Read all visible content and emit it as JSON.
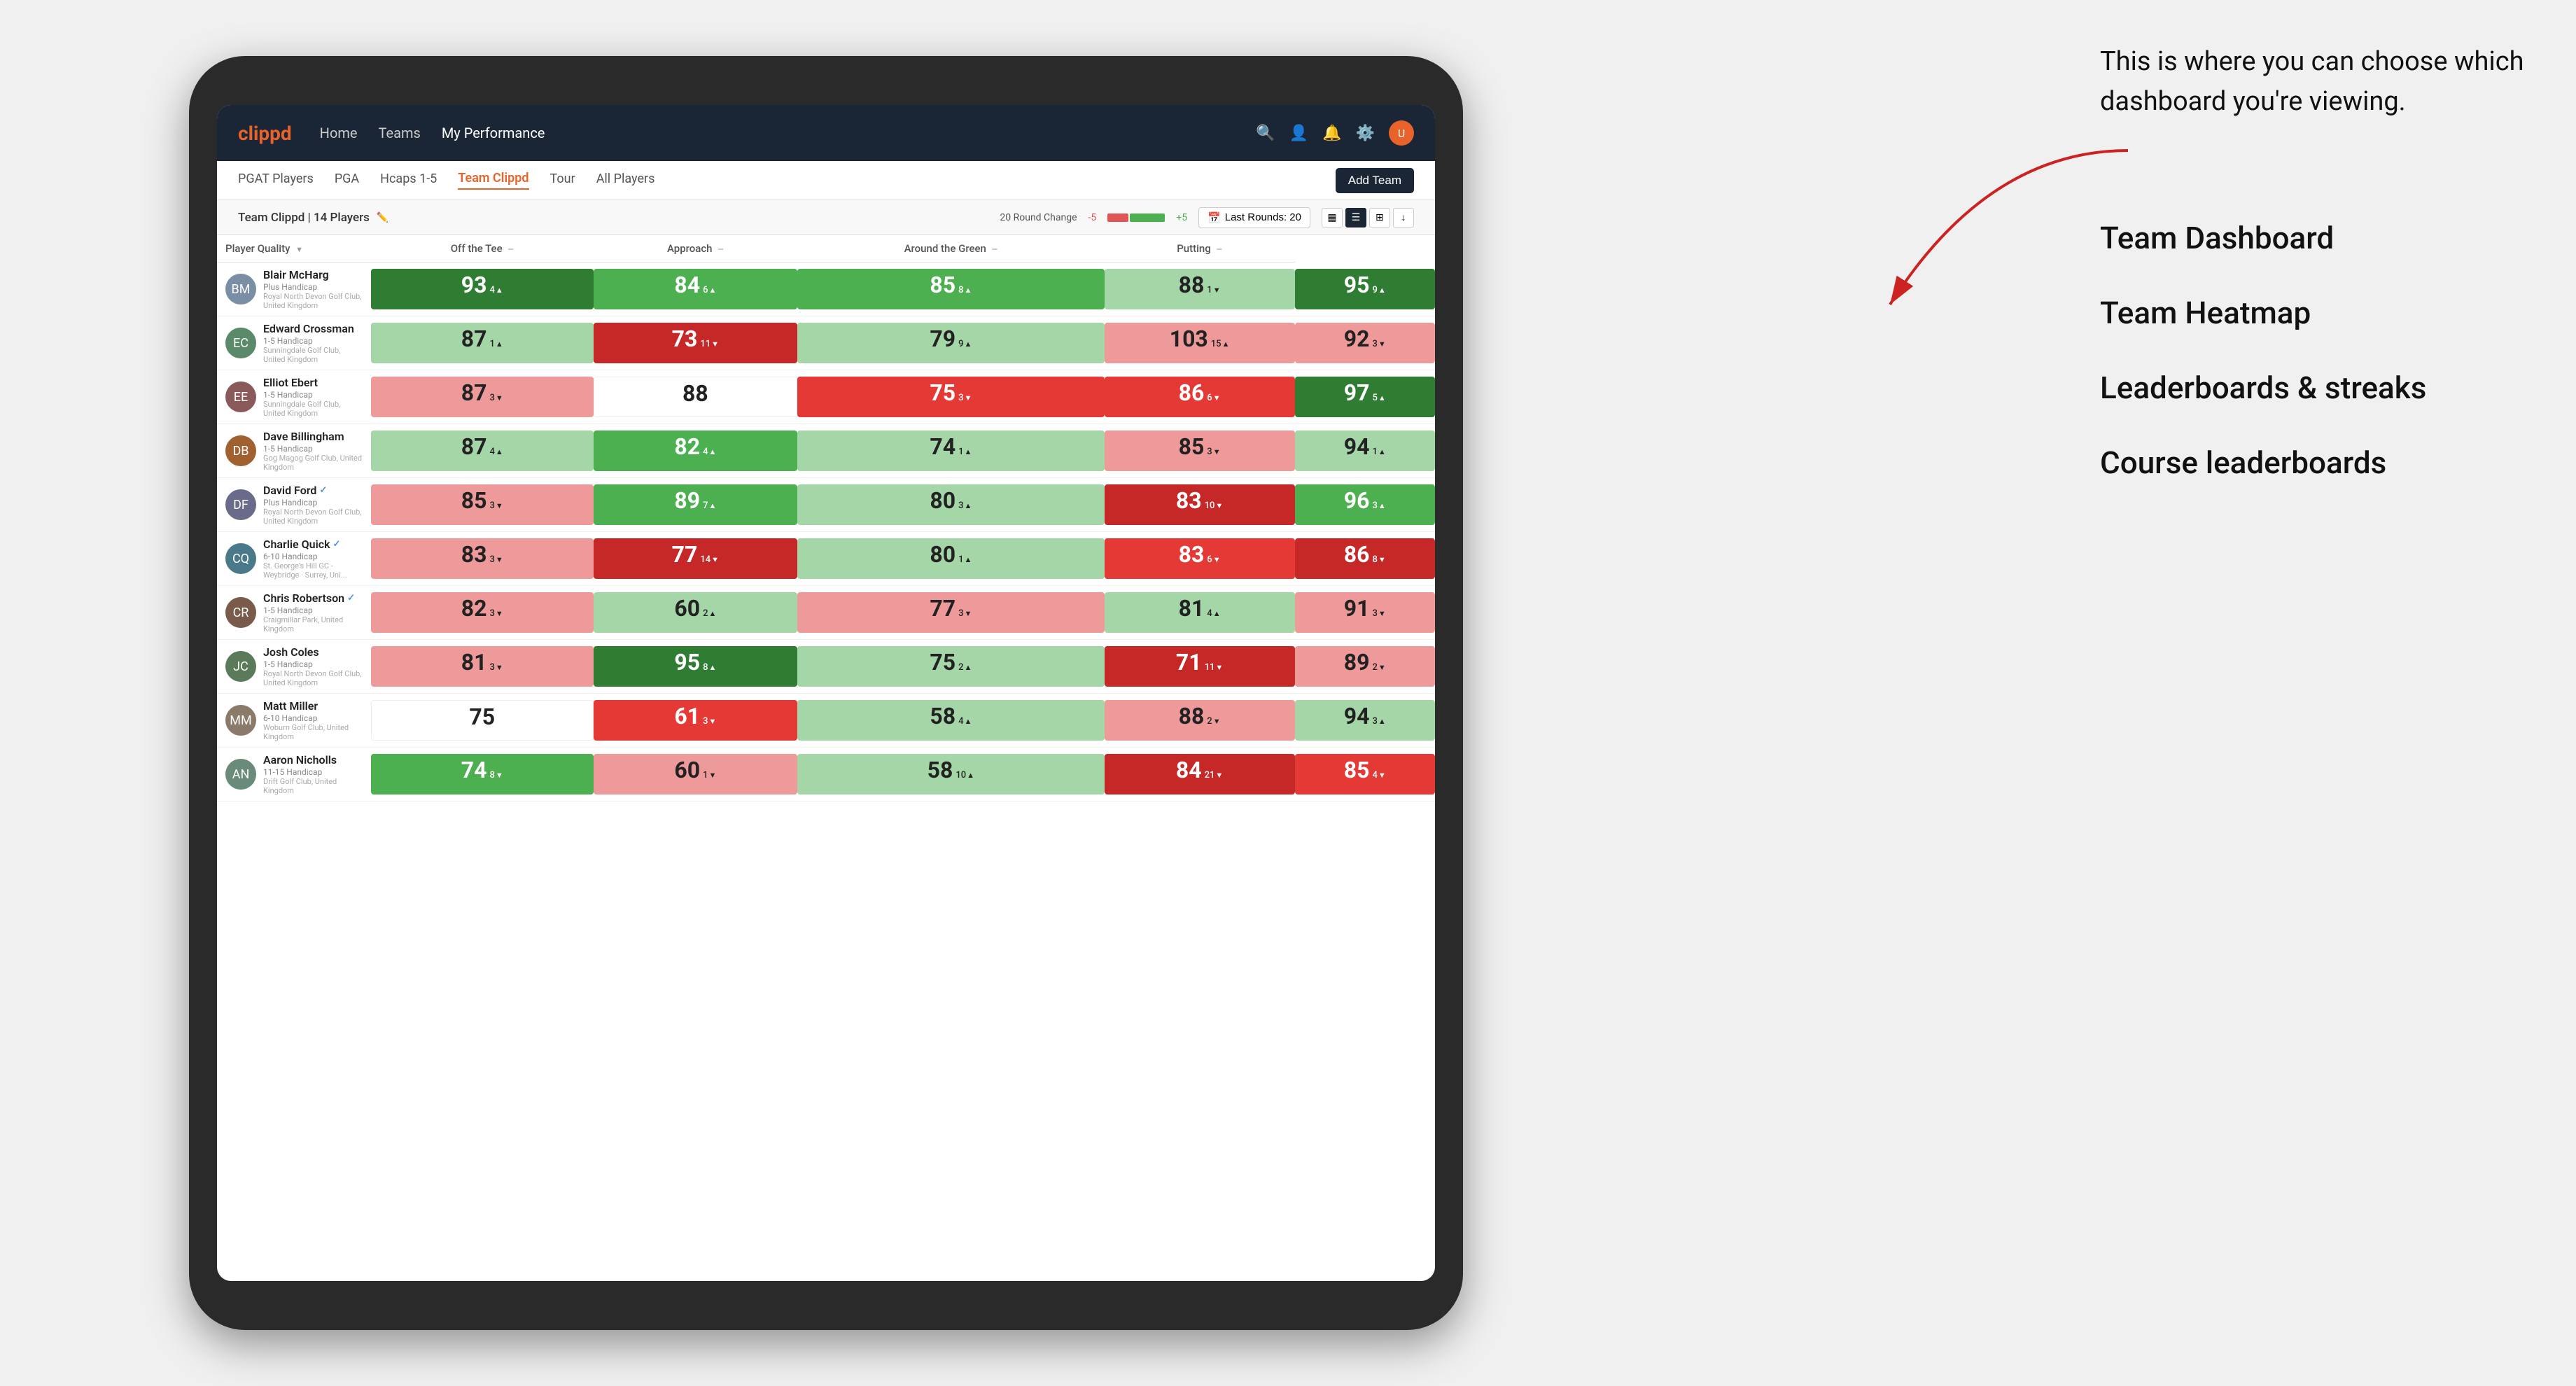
{
  "app": {
    "logo": "clippd",
    "nav": {
      "links": [
        "Home",
        "Teams",
        "My Performance"
      ],
      "active": "My Performance"
    },
    "sub_nav": {
      "links": [
        "PGAT Players",
        "PGA",
        "Hcaps 1-5",
        "Team Clippd",
        "Tour",
        "All Players"
      ],
      "active": "Team Clippd",
      "add_team_label": "Add Team"
    }
  },
  "team": {
    "name": "Team Clippd",
    "player_count": "14 Players",
    "round_change_label": "20 Round Change",
    "change_minus": "-5",
    "change_plus": "+5",
    "last_rounds_label": "Last Rounds: 20"
  },
  "columns": {
    "player": "Player Quality",
    "off_tee": "Off the Tee",
    "approach": "Approach",
    "around_green": "Around the Green",
    "putting": "Putting"
  },
  "players": [
    {
      "name": "Blair McHarg",
      "handicap": "Plus Handicap",
      "club": "Royal North Devon Golf Club, United Kingdom",
      "avatar_color": "#7a8fa6",
      "scores": {
        "quality": {
          "val": 93,
          "change": "4",
          "dir": "up",
          "bg": "green-dark"
        },
        "off_tee": {
          "val": 84,
          "change": "6",
          "dir": "up",
          "bg": "green-med"
        },
        "approach": {
          "val": 85,
          "change": "8",
          "dir": "up",
          "bg": "green-med"
        },
        "around": {
          "val": 88,
          "change": "1",
          "dir": "down",
          "bg": "green-light"
        },
        "putting": {
          "val": 95,
          "change": "9",
          "dir": "up",
          "bg": "green-dark"
        }
      }
    },
    {
      "name": "Edward Crossman",
      "handicap": "1-5 Handicap",
      "club": "Sunningdale Golf Club, United Kingdom",
      "avatar_color": "#5a8a6a",
      "scores": {
        "quality": {
          "val": 87,
          "change": "1",
          "dir": "up",
          "bg": "green-light"
        },
        "off_tee": {
          "val": 73,
          "change": "11",
          "dir": "down",
          "bg": "red-dark"
        },
        "approach": {
          "val": 79,
          "change": "9",
          "dir": "up",
          "bg": "green-light"
        },
        "around": {
          "val": 103,
          "change": "15",
          "dir": "up",
          "bg": "red-light"
        },
        "putting": {
          "val": 92,
          "change": "3",
          "dir": "down",
          "bg": "red-light"
        }
      }
    },
    {
      "name": "Elliot Ebert",
      "handicap": "1-5 Handicap",
      "club": "Sunningdale Golf Club, United Kingdom",
      "avatar_color": "#8a5a5a",
      "scores": {
        "quality": {
          "val": 87,
          "change": "3",
          "dir": "down",
          "bg": "red-light"
        },
        "off_tee": {
          "val": 88,
          "change": "",
          "dir": "",
          "bg": "white"
        },
        "approach": {
          "val": 75,
          "change": "3",
          "dir": "down",
          "bg": "red-med"
        },
        "around": {
          "val": 86,
          "change": "6",
          "dir": "down",
          "bg": "red-med"
        },
        "putting": {
          "val": 97,
          "change": "5",
          "dir": "up",
          "bg": "green-dark"
        }
      }
    },
    {
      "name": "Dave Billingham",
      "handicap": "1-5 Handicap",
      "club": "Gog Magog Golf Club, United Kingdom",
      "avatar_color": "#a06030",
      "scores": {
        "quality": {
          "val": 87,
          "change": "4",
          "dir": "up",
          "bg": "green-light"
        },
        "off_tee": {
          "val": 82,
          "change": "4",
          "dir": "up",
          "bg": "green-med"
        },
        "approach": {
          "val": 74,
          "change": "1",
          "dir": "up",
          "bg": "green-light"
        },
        "around": {
          "val": 85,
          "change": "3",
          "dir": "down",
          "bg": "red-light"
        },
        "putting": {
          "val": 94,
          "change": "1",
          "dir": "up",
          "bg": "green-light"
        }
      }
    },
    {
      "name": "David Ford",
      "handicap": "Plus Handicap",
      "club": "Royal North Devon Golf Club, United Kingdom",
      "avatar_color": "#6a6a8a",
      "verified": true,
      "scores": {
        "quality": {
          "val": 85,
          "change": "3",
          "dir": "down",
          "bg": "red-light"
        },
        "off_tee": {
          "val": 89,
          "change": "7",
          "dir": "up",
          "bg": "green-med"
        },
        "approach": {
          "val": 80,
          "change": "3",
          "dir": "up",
          "bg": "green-light"
        },
        "around": {
          "val": 83,
          "change": "10",
          "dir": "down",
          "bg": "red-dark"
        },
        "putting": {
          "val": 96,
          "change": "3",
          "dir": "up",
          "bg": "green-med"
        }
      }
    },
    {
      "name": "Charlie Quick",
      "handicap": "6-10 Handicap",
      "club": "St. George's Hill GC - Weybridge · Surrey, Uni...",
      "avatar_color": "#4a7a8a",
      "verified": true,
      "scores": {
        "quality": {
          "val": 83,
          "change": "3",
          "dir": "down",
          "bg": "red-light"
        },
        "off_tee": {
          "val": 77,
          "change": "14",
          "dir": "down",
          "bg": "red-dark"
        },
        "approach": {
          "val": 80,
          "change": "1",
          "dir": "up",
          "bg": "green-light"
        },
        "around": {
          "val": 83,
          "change": "6",
          "dir": "down",
          "bg": "red-med"
        },
        "putting": {
          "val": 86,
          "change": "8",
          "dir": "down",
          "bg": "red-dark"
        }
      }
    },
    {
      "name": "Chris Robertson",
      "handicap": "1-5 Handicap",
      "club": "Craigmillar Park, United Kingdom",
      "avatar_color": "#7a5a4a",
      "verified": true,
      "scores": {
        "quality": {
          "val": 82,
          "change": "3",
          "dir": "down",
          "bg": "red-light"
        },
        "off_tee": {
          "val": 60,
          "change": "2",
          "dir": "up",
          "bg": "green-light"
        },
        "approach": {
          "val": 77,
          "change": "3",
          "dir": "down",
          "bg": "red-light"
        },
        "around": {
          "val": 81,
          "change": "4",
          "dir": "up",
          "bg": "green-light"
        },
        "putting": {
          "val": 91,
          "change": "3",
          "dir": "down",
          "bg": "red-light"
        }
      }
    },
    {
      "name": "Josh Coles",
      "handicap": "1-5 Handicap",
      "club": "Royal North Devon Golf Club, United Kingdom",
      "avatar_color": "#5a7a5a",
      "scores": {
        "quality": {
          "val": 81,
          "change": "3",
          "dir": "down",
          "bg": "red-light"
        },
        "off_tee": {
          "val": 95,
          "change": "8",
          "dir": "up",
          "bg": "green-dark"
        },
        "approach": {
          "val": 75,
          "change": "2",
          "dir": "up",
          "bg": "green-light"
        },
        "around": {
          "val": 71,
          "change": "11",
          "dir": "down",
          "bg": "red-dark"
        },
        "putting": {
          "val": 89,
          "change": "2",
          "dir": "down",
          "bg": "red-light"
        }
      }
    },
    {
      "name": "Matt Miller",
      "handicap": "6-10 Handicap",
      "club": "Woburn Golf Club, United Kingdom",
      "avatar_color": "#8a7a6a",
      "scores": {
        "quality": {
          "val": 75,
          "change": "",
          "dir": "",
          "bg": "white"
        },
        "off_tee": {
          "val": 61,
          "change": "3",
          "dir": "down",
          "bg": "red-med"
        },
        "approach": {
          "val": 58,
          "change": "4",
          "dir": "up",
          "bg": "green-light"
        },
        "around": {
          "val": 88,
          "change": "2",
          "dir": "down",
          "bg": "red-light"
        },
        "putting": {
          "val": 94,
          "change": "3",
          "dir": "up",
          "bg": "green-light"
        }
      }
    },
    {
      "name": "Aaron Nicholls",
      "handicap": "11-15 Handicap",
      "club": "Drift Golf Club, United Kingdom",
      "avatar_color": "#6a8a7a",
      "scores": {
        "quality": {
          "val": 74,
          "change": "8",
          "dir": "down",
          "bg": "green-med"
        },
        "off_tee": {
          "val": 60,
          "change": "1",
          "dir": "down",
          "bg": "red-light"
        },
        "approach": {
          "val": 58,
          "change": "10",
          "dir": "up",
          "bg": "green-light"
        },
        "around": {
          "val": 84,
          "change": "21",
          "dir": "down",
          "bg": "red-dark"
        },
        "putting": {
          "val": 85,
          "change": "4",
          "dir": "down",
          "bg": "red-med"
        }
      }
    }
  ],
  "annotation": {
    "tooltip": "This is where you can choose which dashboard you're viewing.",
    "options": [
      "Team Dashboard",
      "Team Heatmap",
      "Leaderboards & streaks",
      "Course leaderboards"
    ]
  }
}
